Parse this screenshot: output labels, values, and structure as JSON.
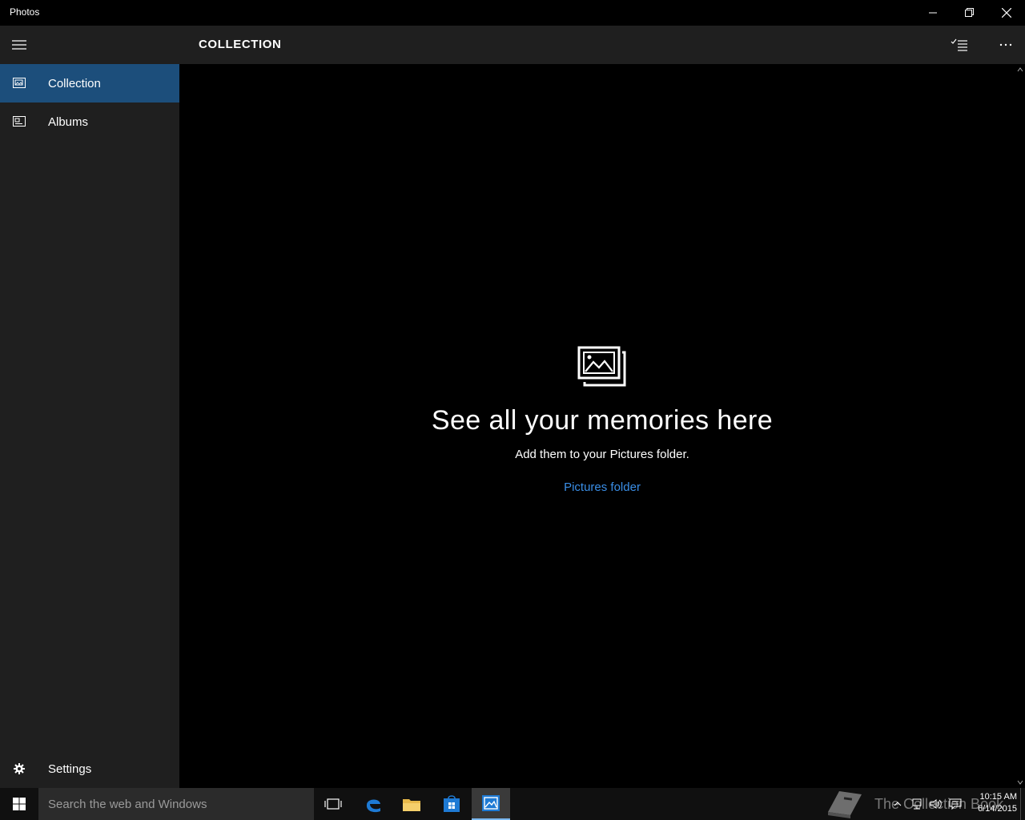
{
  "window": {
    "title": "Photos"
  },
  "header": {
    "title": "COLLECTION"
  },
  "sidebar": {
    "items": [
      {
        "label": "Collection",
        "icon": "collection-icon",
        "active": true
      },
      {
        "label": "Albums",
        "icon": "albums-icon",
        "active": false
      }
    ],
    "settings_label": "Settings"
  },
  "empty_state": {
    "icon": "photos-stack-icon",
    "heading": "See all your memories here",
    "subtext": "Add them to your Pictures folder.",
    "link": "Pictures folder"
  },
  "taskbar": {
    "search_placeholder": "Search the web and Windows",
    "apps": [
      "task-view-icon",
      "edge-icon",
      "file-explorer-icon",
      "store-icon",
      "photos-icon"
    ],
    "active_app": "photos-icon",
    "clock_time": "10:15 AM",
    "clock_date": "6/14/2015",
    "watermark": "The Collection Book"
  },
  "colors": {
    "accent": "#1c4e7b",
    "link": "#3a8ee6",
    "panel": "#1f1f1f",
    "background": "#000000"
  }
}
